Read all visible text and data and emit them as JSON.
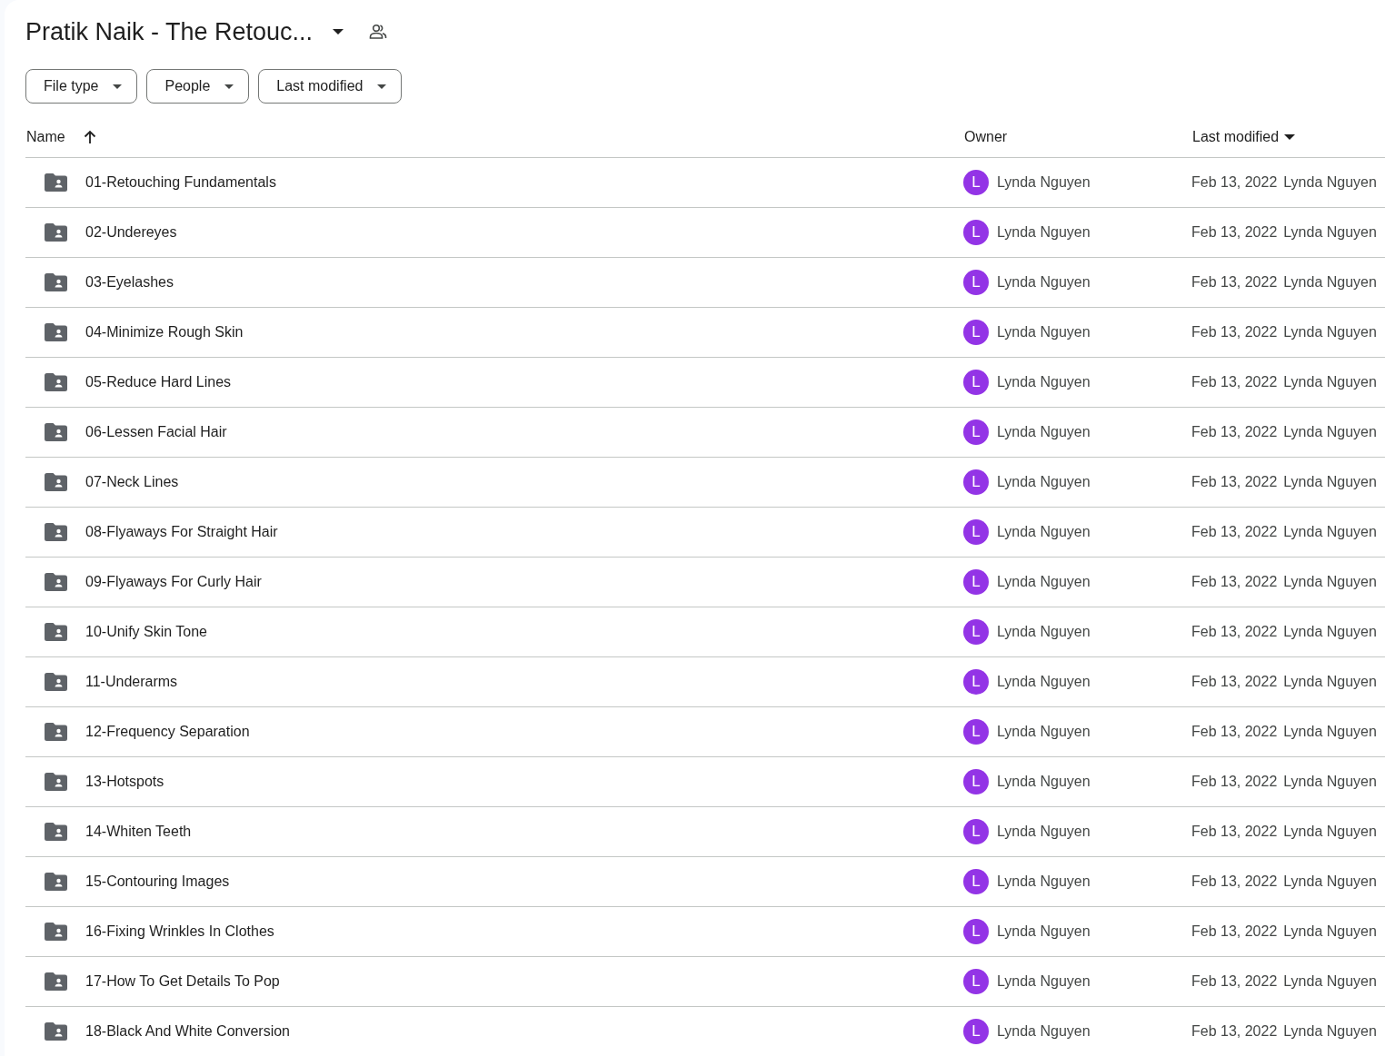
{
  "header": {
    "title": "Pratik Naik - The Retouc..."
  },
  "filters": [
    {
      "label": "File type"
    },
    {
      "label": "People"
    },
    {
      "label": "Last modified"
    }
  ],
  "table": {
    "columns": [
      {
        "label": "Name",
        "kind": "arrow"
      },
      {
        "label": "Owner",
        "kind": "plain"
      },
      {
        "label": "Last modified",
        "kind": "caret"
      }
    ],
    "rows": [
      {
        "name": "01-Retouching Fundamentals",
        "owner": "Lynda Nguyen",
        "avatar": "L",
        "color": "#9334e6",
        "modified": "Feb 13, 2022",
        "modified_by": "Lynda Nguyen"
      },
      {
        "name": "02-Undereyes",
        "owner": "Lynda Nguyen",
        "avatar": "L",
        "color": "#9334e6",
        "modified": "Feb 13, 2022",
        "modified_by": "Lynda Nguyen"
      },
      {
        "name": "03-Eyelashes",
        "owner": "Lynda Nguyen",
        "avatar": "L",
        "color": "#9334e6",
        "modified": "Feb 13, 2022",
        "modified_by": "Lynda Nguyen"
      },
      {
        "name": "04-Minimize Rough Skin",
        "owner": "Lynda Nguyen",
        "avatar": "L",
        "color": "#9334e6",
        "modified": "Feb 13, 2022",
        "modified_by": "Lynda Nguyen"
      },
      {
        "name": "05-Reduce Hard Lines",
        "owner": "Lynda Nguyen",
        "avatar": "L",
        "color": "#9334e6",
        "modified": "Feb 13, 2022",
        "modified_by": "Lynda Nguyen"
      },
      {
        "name": "06-Lessen Facial Hair",
        "owner": "Lynda Nguyen",
        "avatar": "L",
        "color": "#9334e6",
        "modified": "Feb 13, 2022",
        "modified_by": "Lynda Nguyen"
      },
      {
        "name": "07-Neck Lines",
        "owner": "Lynda Nguyen",
        "avatar": "L",
        "color": "#9334e6",
        "modified": "Feb 13, 2022",
        "modified_by": "Lynda Nguyen"
      },
      {
        "name": "08-Flyaways For Straight Hair",
        "owner": "Lynda Nguyen",
        "avatar": "L",
        "color": "#9334e6",
        "modified": "Feb 13, 2022",
        "modified_by": "Lynda Nguyen"
      },
      {
        "name": "09-Flyaways For Curly Hair",
        "owner": "Lynda Nguyen",
        "avatar": "L",
        "color": "#9334e6",
        "modified": "Feb 13, 2022",
        "modified_by": "Lynda Nguyen"
      },
      {
        "name": "10-Unify Skin Tone",
        "owner": "Lynda Nguyen",
        "avatar": "L",
        "color": "#9334e6",
        "modified": "Feb 13, 2022",
        "modified_by": "Lynda Nguyen"
      },
      {
        "name": "11-Underarms",
        "owner": "Lynda Nguyen",
        "avatar": "L",
        "color": "#9334e6",
        "modified": "Feb 13, 2022",
        "modified_by": "Lynda Nguyen"
      },
      {
        "name": "12-Frequency Separation",
        "owner": "Lynda Nguyen",
        "avatar": "L",
        "color": "#9334e6",
        "modified": "Feb 13, 2022",
        "modified_by": "Lynda Nguyen"
      },
      {
        "name": "13-Hotspots",
        "owner": "Lynda Nguyen",
        "avatar": "L",
        "color": "#9334e6",
        "modified": "Feb 13, 2022",
        "modified_by": "Lynda Nguyen"
      },
      {
        "name": "14-Whiten Teeth",
        "owner": "Lynda Nguyen",
        "avatar": "L",
        "color": "#9334e6",
        "modified": "Feb 13, 2022",
        "modified_by": "Lynda Nguyen"
      },
      {
        "name": "15-Contouring Images",
        "owner": "Lynda Nguyen",
        "avatar": "L",
        "color": "#9334e6",
        "modified": "Feb 13, 2022",
        "modified_by": "Lynda Nguyen"
      },
      {
        "name": "16-Fixing Wrinkles In Clothes",
        "owner": "Lynda Nguyen",
        "avatar": "L",
        "color": "#9334e6",
        "modified": "Feb 13, 2022",
        "modified_by": "Lynda Nguyen"
      },
      {
        "name": "17-How To Get Details To Pop",
        "owner": "Lynda Nguyen",
        "avatar": "L",
        "color": "#9334e6",
        "modified": "Feb 13, 2022",
        "modified_by": "Lynda Nguyen"
      },
      {
        "name": "18-Black And White Conversion",
        "owner": "Lynda Nguyen",
        "avatar": "L",
        "color": "#9334e6",
        "modified": "Feb 13, 2022",
        "modified_by": "Lynda Nguyen"
      }
    ]
  }
}
